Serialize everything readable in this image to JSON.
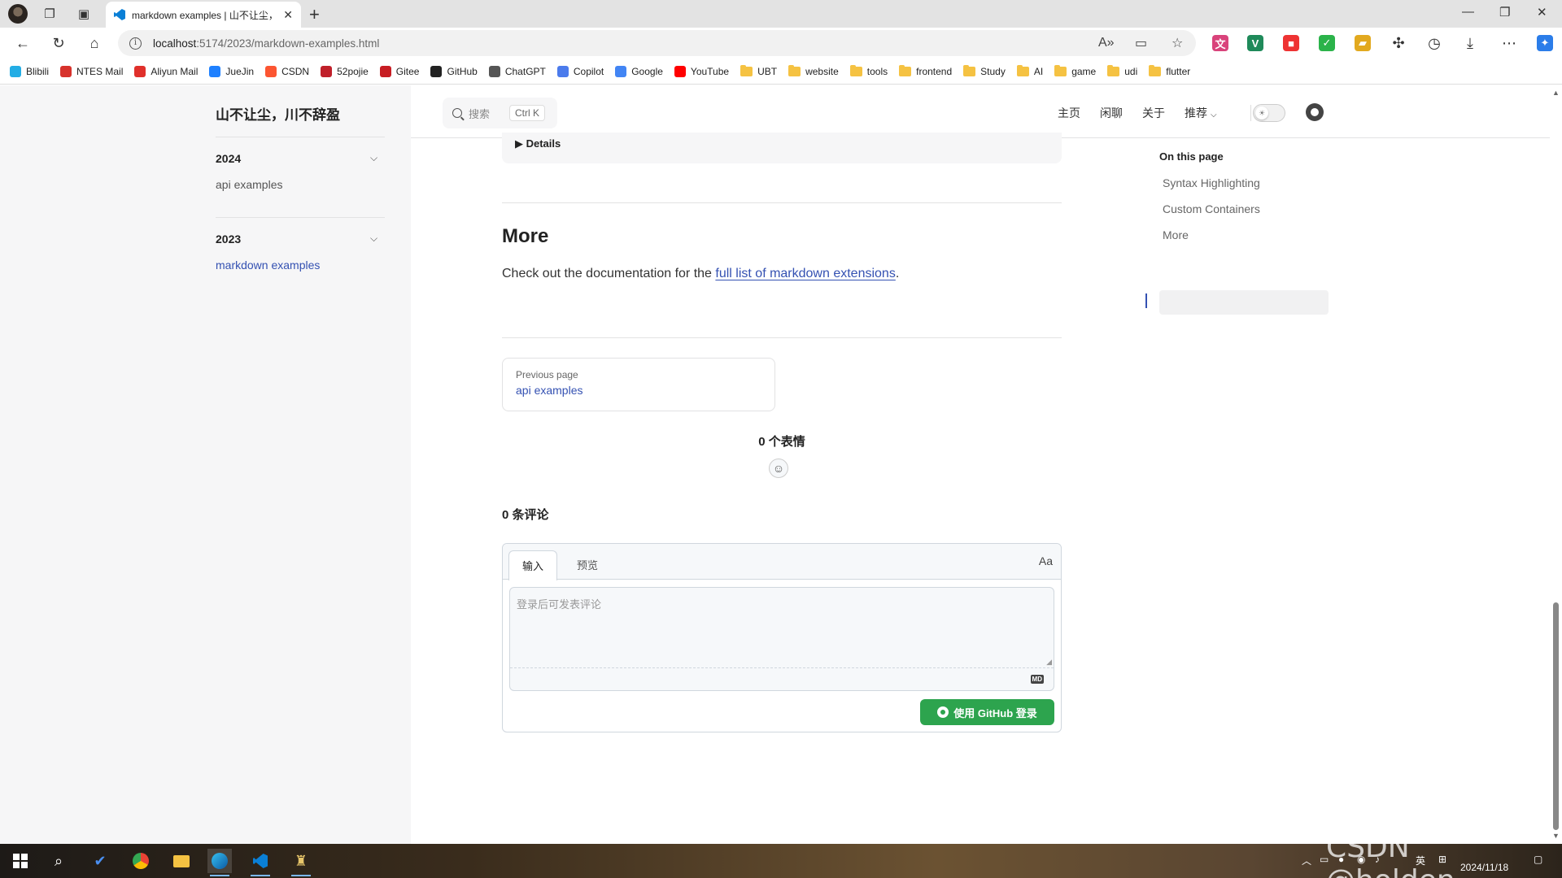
{
  "browser": {
    "tab_title": "markdown examples | 山不让尘，川不辞盈",
    "url_host": "localhost",
    "url_rest": ":5174/2023/markdown-examples.html",
    "bookmarks": [
      {
        "label": "Blibili",
        "icon": "bilibili-icon",
        "color": "#23ade5"
      },
      {
        "label": "NTES Mail",
        "icon": "ntes-mail-icon",
        "color": "#d7322c"
      },
      {
        "label": "Aliyun Mail",
        "icon": "aliyun-mail-icon",
        "color": "#e0302b"
      },
      {
        "label": "JueJin",
        "icon": "juejin-icon",
        "color": "#1e80ff"
      },
      {
        "label": "CSDN",
        "icon": "csdn-icon",
        "color": "#fc5531"
      },
      {
        "label": "52pojie",
        "icon": "52pojie-icon",
        "color": "#c0202a"
      },
      {
        "label": "Gitee",
        "icon": "gitee-icon",
        "color": "#c71d23"
      },
      {
        "label": "GitHub",
        "icon": "github-icon",
        "color": "#222222"
      },
      {
        "label": "ChatGPT",
        "icon": "chatgpt-icon",
        "color": "#555555"
      },
      {
        "label": "Copilot",
        "icon": "copilot-icon",
        "color": "#4b7bec"
      },
      {
        "label": "Google",
        "icon": "google-icon",
        "color": "#4285f4"
      },
      {
        "label": "YouTube",
        "icon": "youtube-icon",
        "color": "#ff0000"
      },
      {
        "label": "UBT",
        "icon": "folder-icon",
        "color": "#f5c242"
      },
      {
        "label": "website",
        "icon": "folder-icon",
        "color": "#f5c242"
      },
      {
        "label": "tools",
        "icon": "folder-icon",
        "color": "#f5c242"
      },
      {
        "label": "frontend",
        "icon": "folder-icon",
        "color": "#f5c242"
      },
      {
        "label": "Study",
        "icon": "folder-icon",
        "color": "#f5c242"
      },
      {
        "label": "AI",
        "icon": "folder-icon",
        "color": "#f5c242"
      },
      {
        "label": "game",
        "icon": "folder-icon",
        "color": "#f5c242"
      },
      {
        "label": "udi",
        "icon": "folder-icon",
        "color": "#f5c242"
      },
      {
        "label": "flutter",
        "icon": "folder-icon",
        "color": "#f5c242"
      }
    ]
  },
  "site": {
    "title": "山不让尘，川不辞盈",
    "search_placeholder": "搜索",
    "search_shortcut": "Ctrl K",
    "nav": {
      "home": "主页",
      "chat": "闲聊",
      "about": "关于",
      "recommend": "推荐"
    }
  },
  "sidebar": {
    "groups": [
      {
        "year": "2024",
        "items": [
          "api examples"
        ]
      },
      {
        "year": "2023",
        "items": [
          "markdown examples"
        ]
      }
    ]
  },
  "content": {
    "details_label": "▶ Details",
    "heading": "More",
    "para_before": "Check out the documentation for the ",
    "para_link": "full list of markdown extensions",
    "para_after": ".",
    "prev_label": "Previous page",
    "prev_value": "api examples",
    "reactions": "0 个表情",
    "comments": "0 条评论",
    "comment_tabs": [
      "输入",
      "预览"
    ],
    "font_toggle": "Aa",
    "comment_placeholder": "登录后可发表评论",
    "md_badge": "MD",
    "login_button": "使用 GitHub 登录"
  },
  "toc": {
    "title": "On this page",
    "items": [
      "Syntax Highlighting",
      "Custom Containers",
      "More"
    ],
    "active": "More"
  },
  "taskbar": {
    "date": "2024/11/18",
    "ime": "英"
  },
  "watermark": "CSDN @holden_"
}
